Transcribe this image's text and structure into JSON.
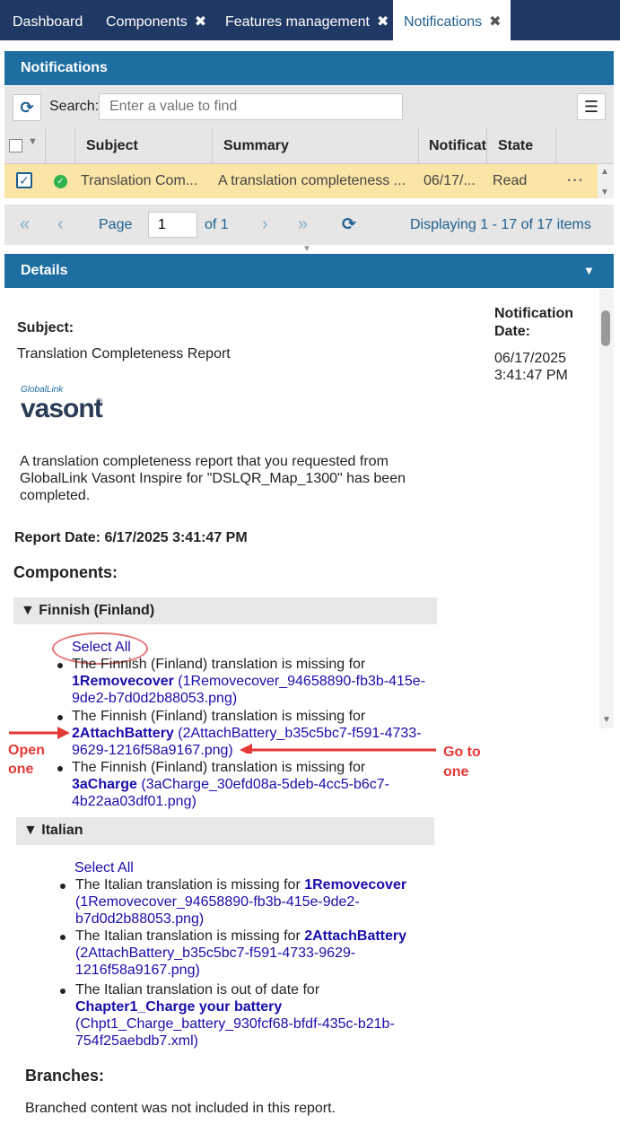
{
  "tabs": [
    {
      "label": "Dashboard"
    },
    {
      "label": "Components"
    },
    {
      "label": "Features management"
    },
    {
      "label": "Notifications"
    }
  ],
  "panel_title": "Notifications",
  "search": {
    "label": "Search:",
    "placeholder": "Enter a value to find"
  },
  "columns": [
    "Subject",
    "Summary",
    "Notificat",
    "State"
  ],
  "row": {
    "subject": "Translation Com...",
    "summary": "A translation completeness ...",
    "date": "06/17/...",
    "state": "Read"
  },
  "pager": {
    "page_label": "Page",
    "page_value": "1",
    "of_label": "of 1",
    "displaying": "Displaying 1 - 17 of 17 items"
  },
  "details_title": "Details",
  "detail": {
    "subject_label": "Subject:",
    "subject": "Translation Completeness Report",
    "notif_date_label1": "Notification",
    "notif_date_label2": "Date:",
    "notif_date1": "06/17/2025",
    "notif_date2": "3:41:47 PM",
    "logo_small": "GlobalLink",
    "logo_big": "vasont",
    "intro1": "A translation completeness report that you requested from",
    "intro2": "GlobalLink Vasont Inspire for \"DSLQR_Map_1300\" has been",
    "intro3": "completed.",
    "report_date": "Report Date: 6/17/2025 3:41:47 PM",
    "components_label": "Components:",
    "finnish": {
      "title": "▼ Finnish (Finland)",
      "select_all": "Select All",
      "items": [
        {
          "text": "The Finnish (Finland) translation is missing for",
          "name": "1Removecover",
          "file1": " (1Removecover_94658890-fb3b-415e-",
          "file2": "9de2-b7d0d2b88053.png)"
        },
        {
          "text": "The Finnish (Finland) translation is missing for",
          "name": "2AttachBattery",
          "file1": " (2AttachBattery_b35c5bc7-f591-4733-",
          "file2": "9629-1216f58a9167.png)"
        },
        {
          "text": "The Finnish (Finland) translation is missing for",
          "name": "3aCharge",
          "file1": " (3aCharge_30efd08a-5deb-4cc5-b6c7-",
          "file2": "4b22aa03df01.png)"
        }
      ]
    },
    "italian": {
      "title": "▼ Italian",
      "select_all": "Select All",
      "items": [
        {
          "text": "The Italian translation is missing for ",
          "name": "1Removecover",
          "file1": "(1Removecover_94658890-fb3b-415e-9de2-",
          "file2": "b7d0d2b88053.png)"
        },
        {
          "text": "The Italian translation is missing for ",
          "name": "2AttachBattery",
          "file1": "(2AttachBattery_b35c5bc7-f591-4733-9629-",
          "file2": "1216f58a9167.png)"
        },
        {
          "text": "The Italian translation is out of date for",
          "name": "Chapter1_Charge your battery",
          "file1": "(Chpt1_Charge_battery_930fcf68-bfdf-435c-b21b-",
          "file2": "754f25aebdb7.xml)"
        }
      ]
    },
    "branches_label": "Branches:",
    "branches_text": "Branched content was not included in this report."
  },
  "annotations": {
    "open1": "Open",
    "open2": "one",
    "goto1": "Go to",
    "goto2": "one"
  },
  "colors": {
    "navy": "#1f3864",
    "header_blue": "#1e6ea1",
    "selected_row": "#fbe5a6",
    "link": "#1a0dab",
    "annotation_red": "#e53935"
  }
}
